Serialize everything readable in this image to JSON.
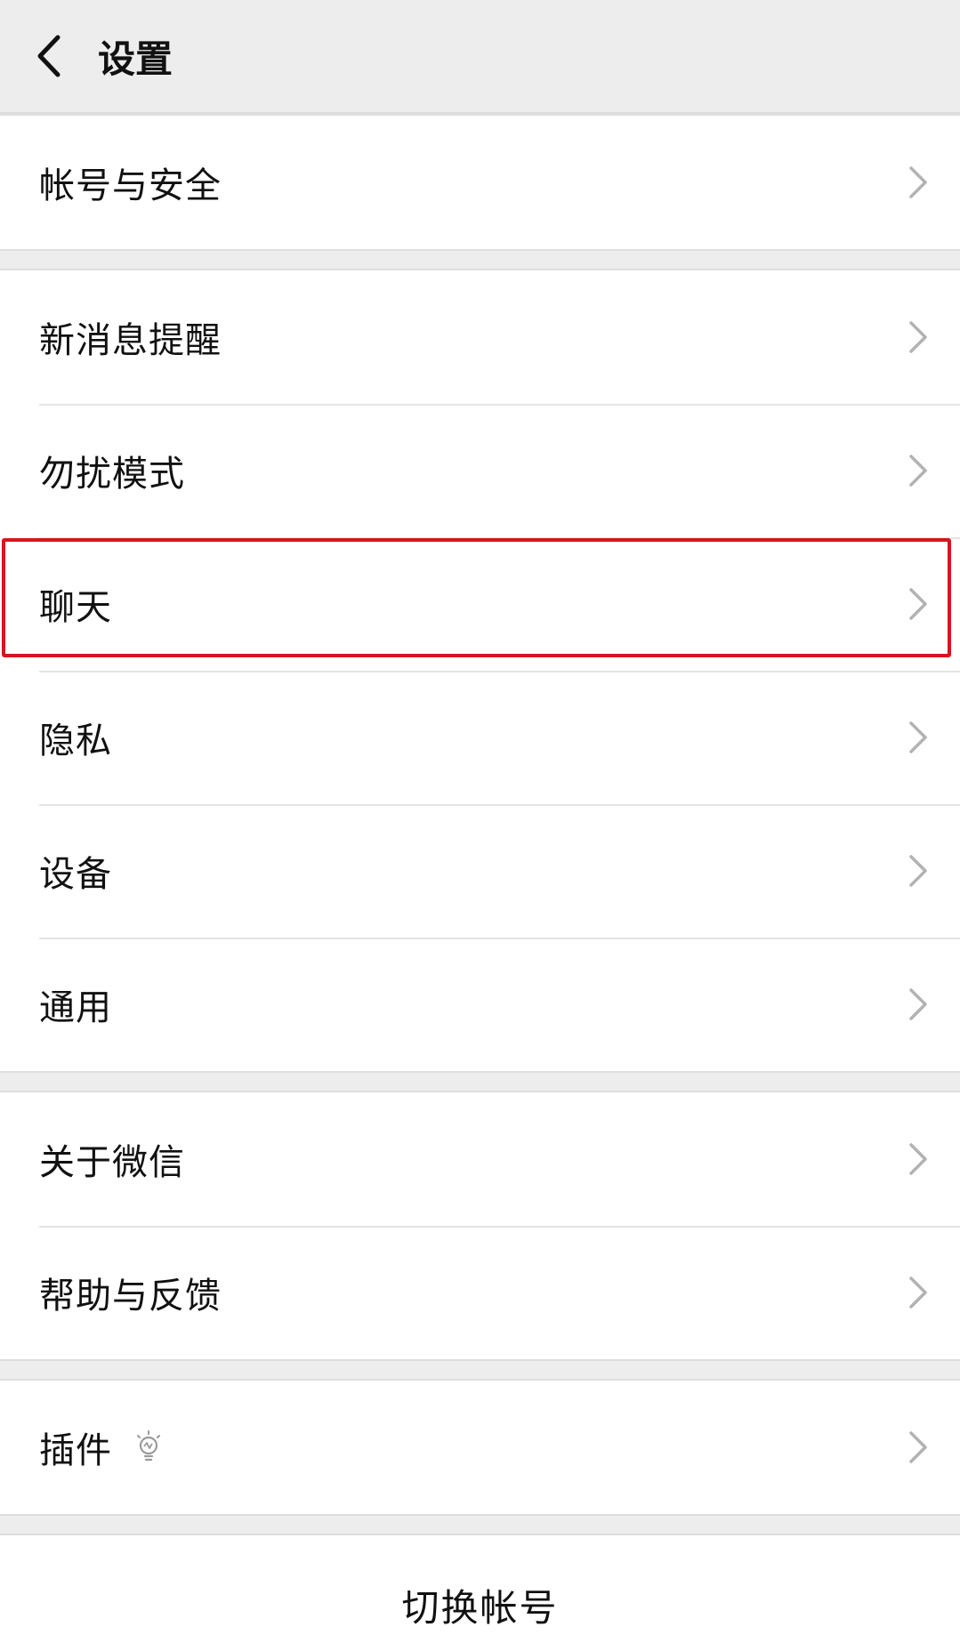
{
  "header": {
    "title": "设置",
    "back_icon": "chevron-left-icon"
  },
  "groups": [
    {
      "items": [
        {
          "label": "帐号与安全"
        }
      ]
    },
    {
      "items": [
        {
          "label": "新消息提醒"
        },
        {
          "label": "勿扰模式"
        },
        {
          "label": "聊天"
        },
        {
          "label": "隐私"
        },
        {
          "label": "设备"
        },
        {
          "label": "通用"
        }
      ]
    },
    {
      "items": [
        {
          "label": "关于微信"
        },
        {
          "label": "帮助与反馈"
        }
      ]
    },
    {
      "items": [
        {
          "label": "插件",
          "icon": "lightbulb-icon"
        }
      ]
    }
  ],
  "footer": {
    "switch_account_label": "切换帐号"
  },
  "colors": {
    "background": "#ededed",
    "row_background": "#ffffff",
    "highlight_border": "#d9141c",
    "chevron": "#b2b2b2"
  }
}
